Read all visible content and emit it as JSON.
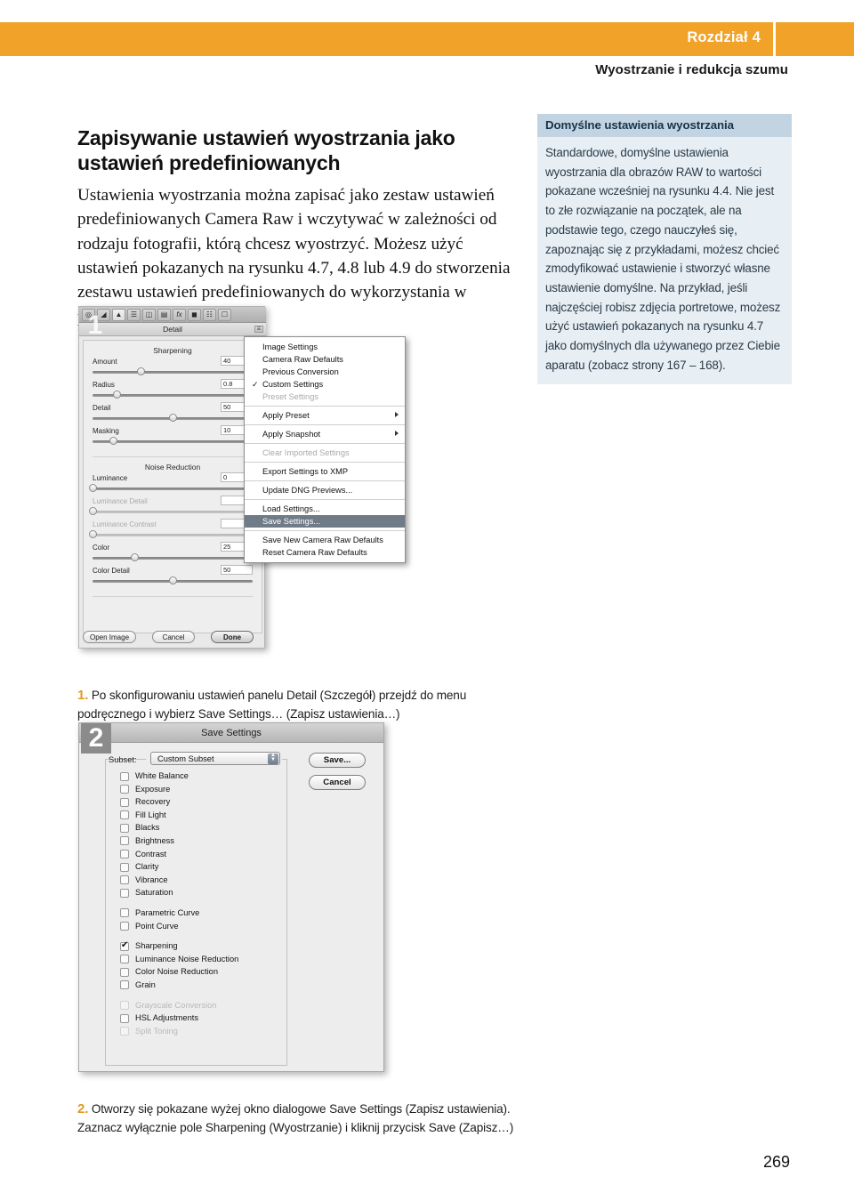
{
  "header": {
    "chapter": "Rozdział 4",
    "subtitle": "Wyostrzanie i redukcja szumu",
    "accent_color": "#f0a229"
  },
  "main": {
    "heading": "Zapisywanie ustawień wyostrzania jako ustawień predefiniowanych",
    "paragraph": "Ustawienia wyostrzania można zapisać jako zestaw ustawień predefiniowanych Camera Raw i wczytywać w zależności od rodzaju fotografii, którą chcesz wyostrzyć. Możesz użyć ustawień pokazanych na rysunku 4.7, 4.8 lub 4.9 do stworzenia zestawu ustawień predefiniowanych do wykorzystania w przyszłości."
  },
  "sidebar": {
    "title": "Domyślne ustawienia wyostrzania",
    "body": "Standardowe, domyślne ustawienia wyostrzania dla obrazów RAW to wartości pokazane wcześniej na rysunku 4.4. Nie jest to złe rozwiązanie na początek, ale na podstawie tego, czego nauczyłeś się, zapoznając się z przykładami, możesz chcieć zmodyfikować ustawienie i stworzyć własne ustawienie domyślne. Na przykład, jeśli najczęściej robisz zdjęcia portretowe, możesz użyć ustawień pokazanych na rysunku 4.7 jako domyślnych dla używanego przez Ciebie aparatu (zobacz strony 167 – 168).",
    "header_bg": "#c2d4e1",
    "body_bg": "#e7eef4"
  },
  "figure1": {
    "badge": "1",
    "panel_tab_title": "Detail",
    "toolbar_icons": [
      "zoom-icon",
      "white-balance-icon",
      "color-sampler-icon",
      "basic-icon",
      "tone-curve-icon",
      "detail-icon",
      "hsl-icon",
      "effects-icon",
      "camera-calibration-icon",
      "presets-icon",
      "snapshots-icon"
    ],
    "sections": [
      {
        "title": "Sharpening"
      },
      {
        "title": "Noise Reduction"
      }
    ],
    "sliders": [
      {
        "label": "Amount",
        "value": "40",
        "pos": 30,
        "disabled": false
      },
      {
        "label": "Radius",
        "value": "0.8",
        "pos": 15,
        "disabled": false
      },
      {
        "label": "Detail",
        "value": "50",
        "pos": 50,
        "disabled": false
      },
      {
        "label": "Masking",
        "value": "10",
        "pos": 13,
        "disabled": false
      },
      {
        "label": "Luminance",
        "value": "0",
        "pos": 0,
        "disabled": false
      },
      {
        "label": "Luminance Detail",
        "value": "",
        "pos": 0,
        "disabled": true
      },
      {
        "label": "Luminance Contrast",
        "value": "",
        "pos": 0,
        "disabled": true
      },
      {
        "label": "Color",
        "value": "25",
        "pos": 26,
        "disabled": false
      },
      {
        "label": "Color Detail",
        "value": "50",
        "pos": 50,
        "disabled": false
      }
    ],
    "buttons": [
      {
        "label": "Open Image",
        "primary": false
      },
      {
        "label": "Cancel",
        "primary": false
      },
      {
        "label": "Done",
        "primary": true
      }
    ],
    "menu": [
      {
        "label": "Image Settings",
        "state": "normal"
      },
      {
        "label": "Camera Raw Defaults",
        "state": "normal"
      },
      {
        "label": "Previous Conversion",
        "state": "normal"
      },
      {
        "label": "Custom Settings",
        "state": "checked"
      },
      {
        "label": "Preset Settings",
        "state": "disabled"
      },
      {
        "separator": true
      },
      {
        "label": "Apply Preset",
        "state": "submenu"
      },
      {
        "separator": true
      },
      {
        "label": "Apply Snapshot",
        "state": "submenu"
      },
      {
        "separator": true
      },
      {
        "label": "Clear Imported Settings",
        "state": "disabled"
      },
      {
        "separator": true
      },
      {
        "label": "Export Settings to XMP",
        "state": "normal"
      },
      {
        "separator": true
      },
      {
        "label": "Update DNG Previews...",
        "state": "normal"
      },
      {
        "separator": true
      },
      {
        "label": "Load Settings...",
        "state": "normal"
      },
      {
        "label": "Save Settings...",
        "state": "highlighted"
      },
      {
        "separator": true
      },
      {
        "label": "Save New Camera Raw Defaults",
        "state": "normal"
      },
      {
        "label": "Reset Camera Raw Defaults",
        "state": "normal"
      }
    ]
  },
  "figure2": {
    "badge": "2",
    "title": "Save Settings",
    "subset_label": "Subset:",
    "subset_value": "Custom Subset",
    "buttons": [
      {
        "label": "Save...",
        "name": "save-button"
      },
      {
        "label": "Cancel",
        "name": "cancel-button"
      }
    ],
    "checkboxes": [
      {
        "label": "White Balance",
        "checked": false,
        "disabled": false
      },
      {
        "label": "Exposure",
        "checked": false,
        "disabled": false
      },
      {
        "label": "Recovery",
        "checked": false,
        "disabled": false
      },
      {
        "label": "Fill Light",
        "checked": false,
        "disabled": false
      },
      {
        "label": "Blacks",
        "checked": false,
        "disabled": false
      },
      {
        "label": "Brightness",
        "checked": false,
        "disabled": false
      },
      {
        "label": "Contrast",
        "checked": false,
        "disabled": false
      },
      {
        "label": "Clarity",
        "checked": false,
        "disabled": false
      },
      {
        "label": "Vibrance",
        "checked": false,
        "disabled": false
      },
      {
        "label": "Saturation",
        "checked": false,
        "disabled": false
      },
      {
        "gap": true
      },
      {
        "label": "Parametric Curve",
        "checked": false,
        "disabled": false
      },
      {
        "label": "Point Curve",
        "checked": false,
        "disabled": false
      },
      {
        "gap": true
      },
      {
        "label": "Sharpening",
        "checked": true,
        "disabled": false
      },
      {
        "label": "Luminance Noise Reduction",
        "checked": false,
        "disabled": false
      },
      {
        "label": "Color Noise Reduction",
        "checked": false,
        "disabled": false
      },
      {
        "label": "Grain",
        "checked": false,
        "disabled": false
      },
      {
        "gap": true
      },
      {
        "label": "Grayscale Conversion",
        "checked": false,
        "disabled": true
      },
      {
        "label": "HSL Adjustments",
        "checked": false,
        "disabled": false
      },
      {
        "label": "Split Toning",
        "checked": false,
        "disabled": true
      }
    ]
  },
  "steps": [
    {
      "num": "1.",
      "text": "Po skonfigurowaniu ustawień panelu Detail (Szczegół) przejdź do menu podręcznego i wybierz Save Settings… (Zapisz ustawienia…)"
    },
    {
      "num": "2.",
      "text": "Otworzy się pokazane wyżej okno dialogowe Save Settings (Zapisz ustawienia). Zaznacz wyłącznie pole Sharpening (Wyostrzanie) i kliknij przycisk Save (Zapisz…)"
    }
  ],
  "page_number": "269"
}
